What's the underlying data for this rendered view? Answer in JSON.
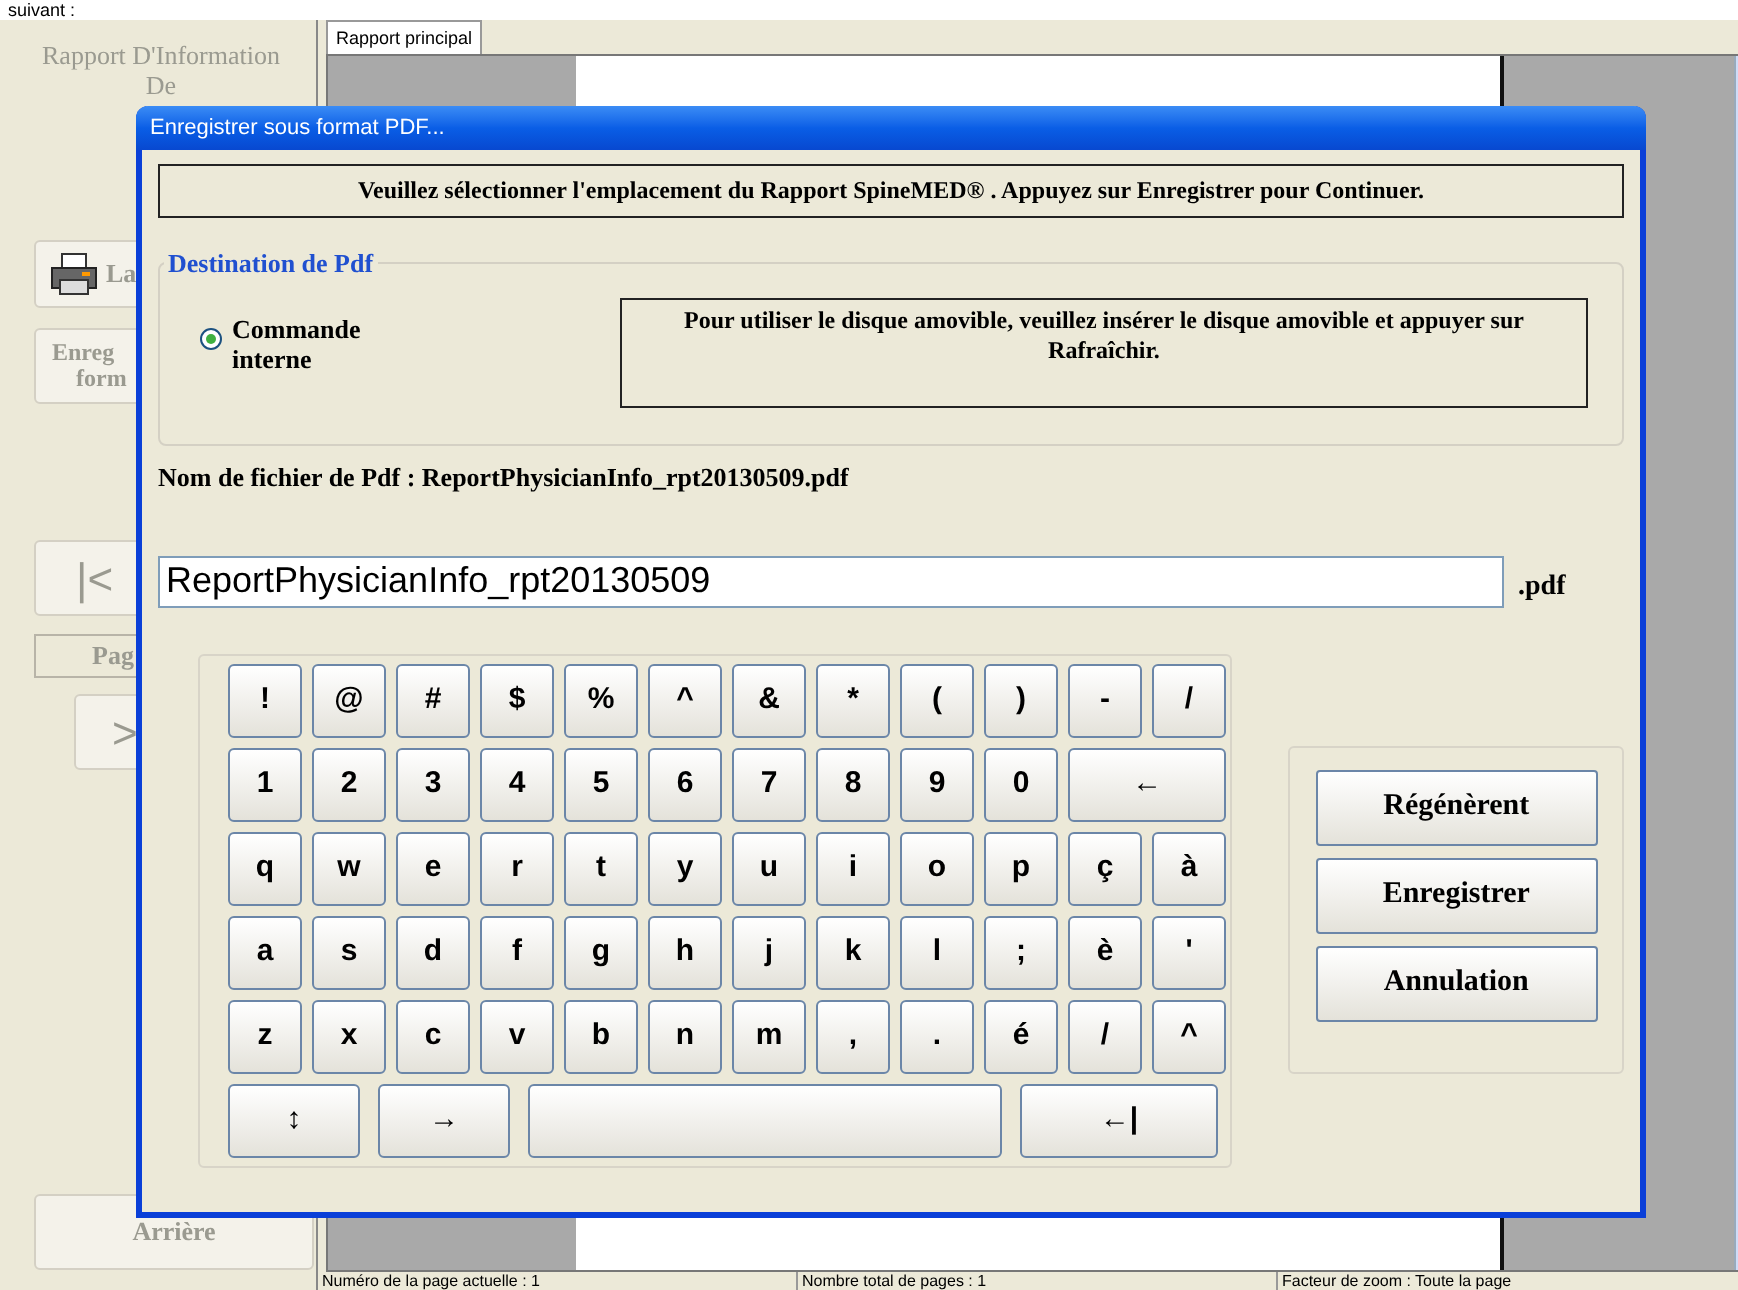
{
  "top_text": "suivant :",
  "sidebar": {
    "title": "Rapport D'Information De",
    "print_button": "La",
    "save_button": [
      "Enreg",
      "form"
    ],
    "first_button": "|<",
    "page_label": "Pag",
    "next_button": ">",
    "back_button": "Arrière"
  },
  "tabs": [
    {
      "label": "Rapport principal",
      "selected": true
    }
  ],
  "status_bar": [
    "Numéro de la page actuelle : 1",
    "Nombre total de pages : 1",
    "Facteur de zoom : Toute la page"
  ],
  "dialog": {
    "title": "Enregistrer sous format PDF...",
    "instruction": "Veuillez sélectionner l'emplacement du Rapport SpineMED® . Appuyez sur Enregistrer pour Continuer.",
    "destination": {
      "legend": "Destination de Pdf",
      "options": [
        {
          "label": "Commande interne",
          "selected": true
        }
      ],
      "note": "Pour utiliser le disque amovible, veuillez insérer le disque amovible et appuyer sur Rafraîchir."
    },
    "filename_label": "Nom de fichier de Pdf : ReportPhysicianInfo_rpt20130509.pdf",
    "filename_value": "ReportPhysicianInfo_rpt20130509",
    "extension": ".pdf",
    "keyboard": [
      [
        {
          "label": "!",
          "kind": "char"
        },
        {
          "label": "@",
          "kind": "char"
        },
        {
          "label": "#",
          "kind": "char"
        },
        {
          "label": "$",
          "kind": "char"
        },
        {
          "label": "%",
          "kind": "char"
        },
        {
          "label": "^",
          "kind": "char"
        },
        {
          "label": "&",
          "kind": "char"
        },
        {
          "label": "*",
          "kind": "char"
        },
        {
          "label": "(",
          "kind": "char"
        },
        {
          "label": ")",
          "kind": "char"
        },
        {
          "label": "-",
          "kind": "char"
        },
        {
          "label": "/",
          "kind": "char"
        }
      ],
      [
        {
          "label": "1",
          "kind": "char"
        },
        {
          "label": "2",
          "kind": "char"
        },
        {
          "label": "3",
          "kind": "char"
        },
        {
          "label": "4",
          "kind": "char"
        },
        {
          "label": "5",
          "kind": "char"
        },
        {
          "label": "6",
          "kind": "char"
        },
        {
          "label": "7",
          "kind": "char"
        },
        {
          "label": "8",
          "kind": "char"
        },
        {
          "label": "9",
          "kind": "char"
        },
        {
          "label": "0",
          "kind": "char"
        },
        {
          "label": "←",
          "kind": "double"
        }
      ],
      [
        {
          "label": "q",
          "kind": "char"
        },
        {
          "label": "w",
          "kind": "char"
        },
        {
          "label": "e",
          "kind": "char"
        },
        {
          "label": "r",
          "kind": "char"
        },
        {
          "label": "t",
          "kind": "char"
        },
        {
          "label": "y",
          "kind": "char"
        },
        {
          "label": "u",
          "kind": "char"
        },
        {
          "label": "i",
          "kind": "char"
        },
        {
          "label": "o",
          "kind": "char"
        },
        {
          "label": "p",
          "kind": "char"
        },
        {
          "label": "ç",
          "kind": "char"
        },
        {
          "label": "à",
          "kind": "char"
        }
      ],
      [
        {
          "label": "a",
          "kind": "char"
        },
        {
          "label": "s",
          "kind": "char"
        },
        {
          "label": "d",
          "kind": "char"
        },
        {
          "label": "f",
          "kind": "char"
        },
        {
          "label": "g",
          "kind": "char"
        },
        {
          "label": "h",
          "kind": "char"
        },
        {
          "label": "j",
          "kind": "char"
        },
        {
          "label": "k",
          "kind": "char"
        },
        {
          "label": "l",
          "kind": "char"
        },
        {
          "label": ";",
          "kind": "char"
        },
        {
          "label": "è",
          "kind": "char"
        },
        {
          "label": "'",
          "kind": "char"
        }
      ],
      [
        {
          "label": "z",
          "kind": "char"
        },
        {
          "label": "x",
          "kind": "char"
        },
        {
          "label": "c",
          "kind": "char"
        },
        {
          "label": "v",
          "kind": "char"
        },
        {
          "label": "b",
          "kind": "char"
        },
        {
          "label": "n",
          "kind": "char"
        },
        {
          "label": "m",
          "kind": "char"
        },
        {
          "label": ",",
          "kind": "char"
        },
        {
          "label": ".",
          "kind": "char"
        },
        {
          "label": "é",
          "kind": "char"
        },
        {
          "label": "/",
          "kind": "char"
        },
        {
          "label": "^",
          "kind": "char"
        }
      ],
      [
        {
          "label": "↕",
          "kind": "medium"
        },
        {
          "label": "→",
          "kind": "medium"
        },
        {
          "kind": "space"
        },
        {
          "label": "←|",
          "kind": "enter"
        }
      ]
    ],
    "actions": [
      "Régénèrent",
      "Enregistrer",
      "Annulation"
    ]
  }
}
